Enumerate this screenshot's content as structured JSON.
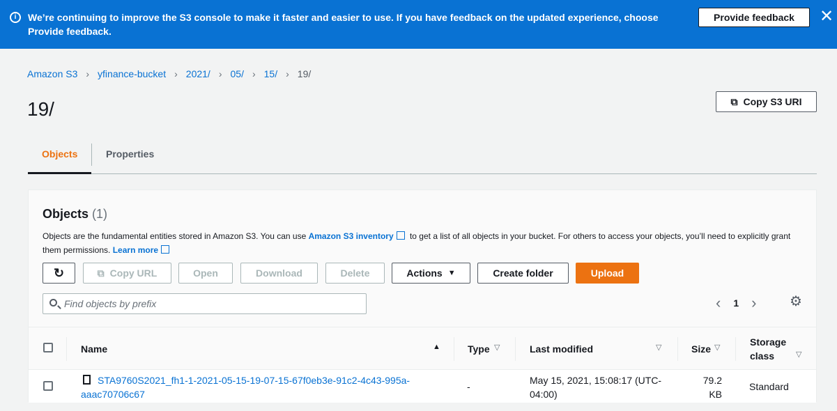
{
  "banner": {
    "message": "We’re continuing to improve the S3 console to make it faster and easier to use. If you have feedback on the updated experience, choose Provide feedback.",
    "button": "Provide feedback"
  },
  "breadcrumb": [
    "Amazon S3",
    "yfinance-bucket",
    "2021/",
    "05/",
    "15/",
    "19/"
  ],
  "page": {
    "title": "19/",
    "copy_uri": "Copy S3 URI"
  },
  "tabs": [
    "Objects",
    "Properties"
  ],
  "panel": {
    "title": "Objects",
    "count": "(1)",
    "desc_1": "Objects are the fundamental entities stored in Amazon S3. You can use",
    "desc_link_1": "Amazon S3 inventory",
    "desc_2": "to get a list of all objects in your bucket. For others to access your objects, you’ll need to explicitly grant them permissions.",
    "desc_link_2": "Learn more"
  },
  "toolbar": {
    "copy_url": "Copy URL",
    "open": "Open",
    "download": "Download",
    "delete": "Delete",
    "actions": "Actions",
    "create_folder": "Create folder",
    "upload": "Upload"
  },
  "search": {
    "placeholder": "Find objects by prefix"
  },
  "pagination": {
    "page": "1"
  },
  "table": {
    "headers": {
      "name": "Name",
      "type": "Type",
      "last_modified": "Last modified",
      "size": "Size",
      "storage_class_1": "Storage",
      "storage_class_2": "class"
    },
    "rows": [
      {
        "name_1": "STA9760S2021_fh1-1-2021-05-15-19-07-15-67f0eb3e-91c2-4c43-995a-",
        "name_2": "aaac70706c67",
        "type": "-",
        "modified_1": "May 15, 2021, 15:08:17 (UTC-",
        "modified_2": "04:00)",
        "size_1": "79.2",
        "size_2": "KB",
        "storage_class": "Standard"
      }
    ]
  }
}
